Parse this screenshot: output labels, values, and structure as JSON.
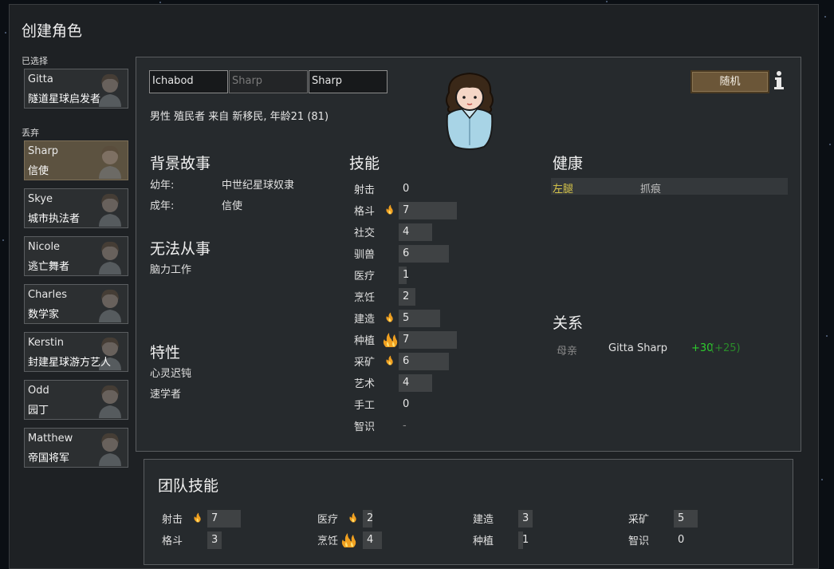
{
  "window": {
    "title": "创建角色"
  },
  "sidebar": {
    "chosen_label": "已选择",
    "chosen": [
      {
        "name": "Gitta",
        "title": "隧道星球启发者"
      }
    ],
    "left_behind_label": "丢弃",
    "left_behind": [
      {
        "name": "Sharp",
        "title": "信使"
      },
      {
        "name": "Skye",
        "title": "城市执法者"
      },
      {
        "name": "Nicole",
        "title": "逃亡舞者"
      },
      {
        "name": "Charles",
        "title": "数学家"
      },
      {
        "name": "Kerstin",
        "title": "封建星球游方艺人"
      },
      {
        "name": "Odd",
        "title": "园丁"
      },
      {
        "name": "Matthew",
        "title": "帝国将军"
      }
    ]
  },
  "pawn": {
    "first_name": "Ichabod",
    "nick_placeholder": "Sharp",
    "last_name": "Sharp",
    "description": "男性 殖民者 来自 新移民, 年龄21 (81)",
    "randomize_label": "随机",
    "info_icon": "info-icon"
  },
  "backstory": {
    "heading": "背景故事",
    "childhood_label": "幼年:",
    "childhood": "中世纪星球奴隶",
    "adulthood_label": "成年:",
    "adulthood": "信使"
  },
  "incapable": {
    "heading": "无法从事",
    "items": [
      "脑力工作"
    ]
  },
  "traits": {
    "heading": "特性",
    "items": [
      "心灵迟钝",
      "速学者"
    ]
  },
  "skills": {
    "heading": "技能",
    "list": [
      {
        "name": "射击",
        "value": "0",
        "level": 0,
        "passion": 0
      },
      {
        "name": "格斗",
        "value": "7",
        "level": 7,
        "passion": 1
      },
      {
        "name": "社交",
        "value": "4",
        "level": 4,
        "passion": 0
      },
      {
        "name": "驯兽",
        "value": "6",
        "level": 6,
        "passion": 0
      },
      {
        "name": "医疗",
        "value": "1",
        "level": 1,
        "passion": 0
      },
      {
        "name": "烹饪",
        "value": "2",
        "level": 2,
        "passion": 0
      },
      {
        "name": "建造",
        "value": "5",
        "level": 5,
        "passion": 1
      },
      {
        "name": "种植",
        "value": "7",
        "level": 7,
        "passion": 2
      },
      {
        "name": "采矿",
        "value": "6",
        "level": 6,
        "passion": 1
      },
      {
        "name": "艺术",
        "value": "4",
        "level": 4,
        "passion": 0
      },
      {
        "name": "手工",
        "value": "0",
        "level": 0,
        "passion": 0
      },
      {
        "name": "智识",
        "value": "-",
        "level": 0,
        "passion": 0
      }
    ]
  },
  "health": {
    "heading": "健康",
    "rows": [
      {
        "part": "左腿",
        "condition": "抓痕",
        "part_color": "#d8c64a"
      }
    ]
  },
  "relations": {
    "heading": "关系",
    "rows": [
      {
        "relation": "母亲",
        "name": "Gitta Sharp",
        "opinion": "+30",
        "opinion_detail": "(+25)"
      }
    ]
  },
  "team_skills": {
    "heading": "团队技能",
    "list": [
      {
        "name": "射击",
        "value": "7",
        "level": 7,
        "passion": 1
      },
      {
        "name": "格斗",
        "value": "3",
        "level": 3,
        "passion": 0
      },
      {
        "name": "医疗",
        "value": "2",
        "level": 2,
        "passion": 1
      },
      {
        "name": "烹饪",
        "value": "4",
        "level": 4,
        "passion": 2
      },
      {
        "name": "建造",
        "value": "3",
        "level": 3,
        "passion": 0
      },
      {
        "name": "种植",
        "value": "1",
        "level": 1,
        "passion": 0
      },
      {
        "name": "采矿",
        "value": "5",
        "level": 5,
        "passion": 0
      },
      {
        "name": "智识",
        "value": "0",
        "level": 0,
        "passion": 0
      }
    ]
  },
  "colors": {
    "accent_button": "#6b5638",
    "selected_pawn": "#5c5240",
    "opinion_positive": "#2ecc2e",
    "opinion_detail": "#2a8a2a",
    "passion_flame": "#f0a020"
  }
}
